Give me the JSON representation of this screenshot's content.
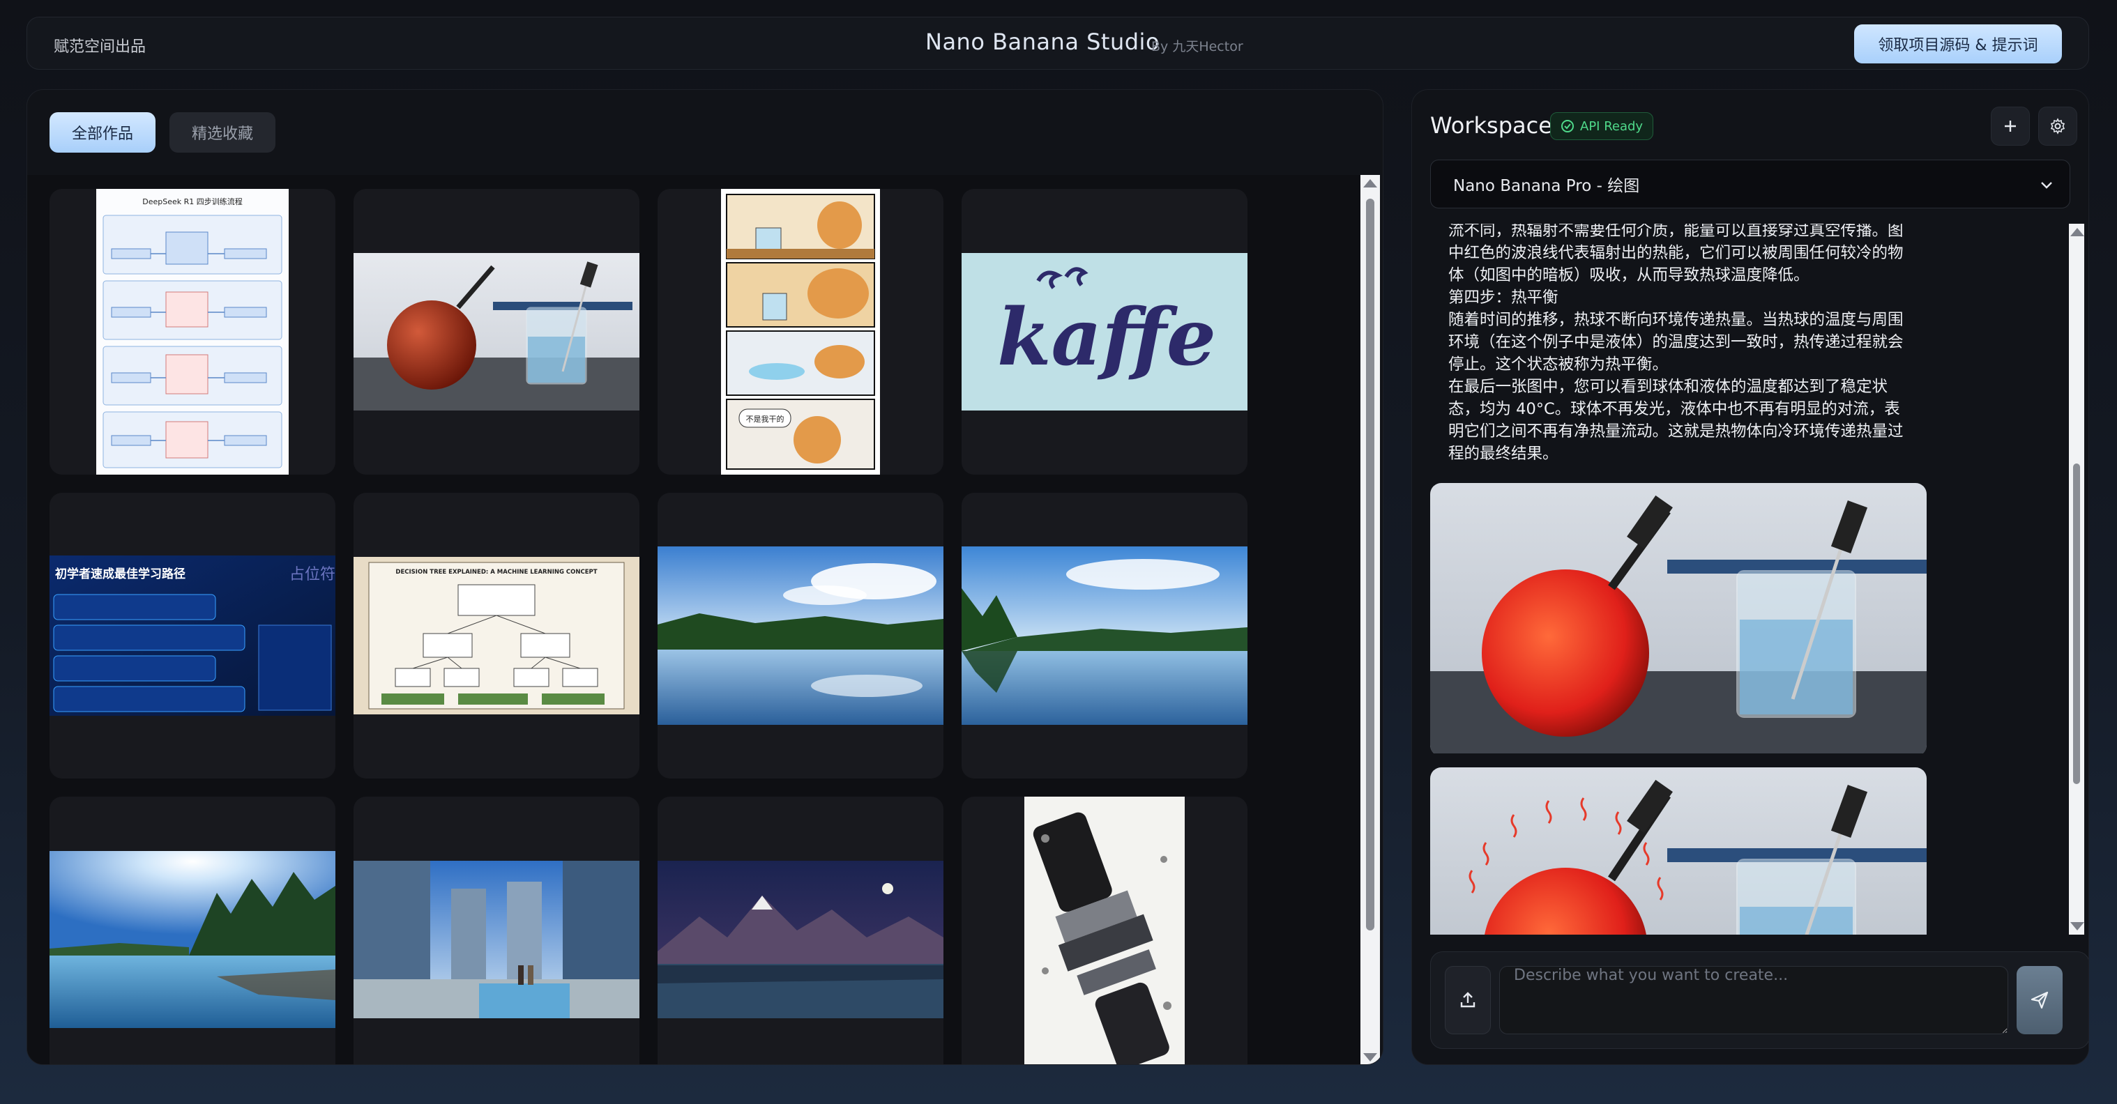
{
  "header": {
    "brand": "赋范空间出品",
    "title": "Nano Banana Studio",
    "author": "By 九天Hector",
    "source_button": "领取项目源码 & 提示词"
  },
  "gallery": {
    "tabs": [
      {
        "label": "全部作品",
        "active": true
      },
      {
        "label": "精选收藏",
        "active": false
      }
    ],
    "items": [
      {
        "name": "deepseek-training-flowchart",
        "title": "DeepSeek R1 四步训练流程",
        "kind": "flowchart"
      },
      {
        "name": "sphere-thermometer-beaker",
        "kind": "photo"
      },
      {
        "name": "cat-comic-strip",
        "caption": "不是我干的",
        "kind": "comic"
      },
      {
        "name": "kaffe-logo",
        "text": "kaffe",
        "kind": "logo"
      },
      {
        "name": "rag-learning-path",
        "title": "初学者速成最佳学习路径",
        "side": "占位符",
        "kind": "infographic"
      },
      {
        "name": "decision-tree-poster",
        "title": "DECISION TREE EXPLAINED: A MACHINE LEARNING CONCEPT",
        "kind": "poster"
      },
      {
        "name": "lake-landscape-1",
        "kind": "photo"
      },
      {
        "name": "lake-landscape-2",
        "kind": "photo"
      },
      {
        "name": "lake-sun-trees",
        "kind": "photo"
      },
      {
        "name": "city-street-couple",
        "kind": "photo"
      },
      {
        "name": "mountain-night-sky",
        "kind": "photo"
      },
      {
        "name": "iphone-exploded-view",
        "kind": "diagram"
      }
    ]
  },
  "workspace": {
    "title": "Workspace",
    "api_status": "API Ready",
    "model": "Nano Banana Pro - 绘图",
    "message_lines": [
      "流不同，热辐射不需要任何介质，能量可以直接穿过真空传播。图",
      "中红色的波浪线代表辐射出的热能，它们可以被周围任何较冷的物",
      "体（如图中的暗板）吸收，从而导致热球温度降低。",
      "第四步：热平衡",
      "随着时间的推移，热球不断向环境传递热量。当热球的温度与周围",
      "环境（在这个例子中是液体）的温度达到一致时，热传递过程就会",
      "停止。这个状态被称为热平衡。",
      "在最后一张图中，您可以看到球体和液体的温度都达到了稳定状",
      "态，均为 40°C。球体不再发光，液体中也不再有明显的对流，表",
      "明它们之间不再有净热量流动。这就是热物体向冷环境传递热量过",
      "程的最终结果。"
    ],
    "composer": {
      "placeholder": "Describe what you want to create..."
    }
  }
}
